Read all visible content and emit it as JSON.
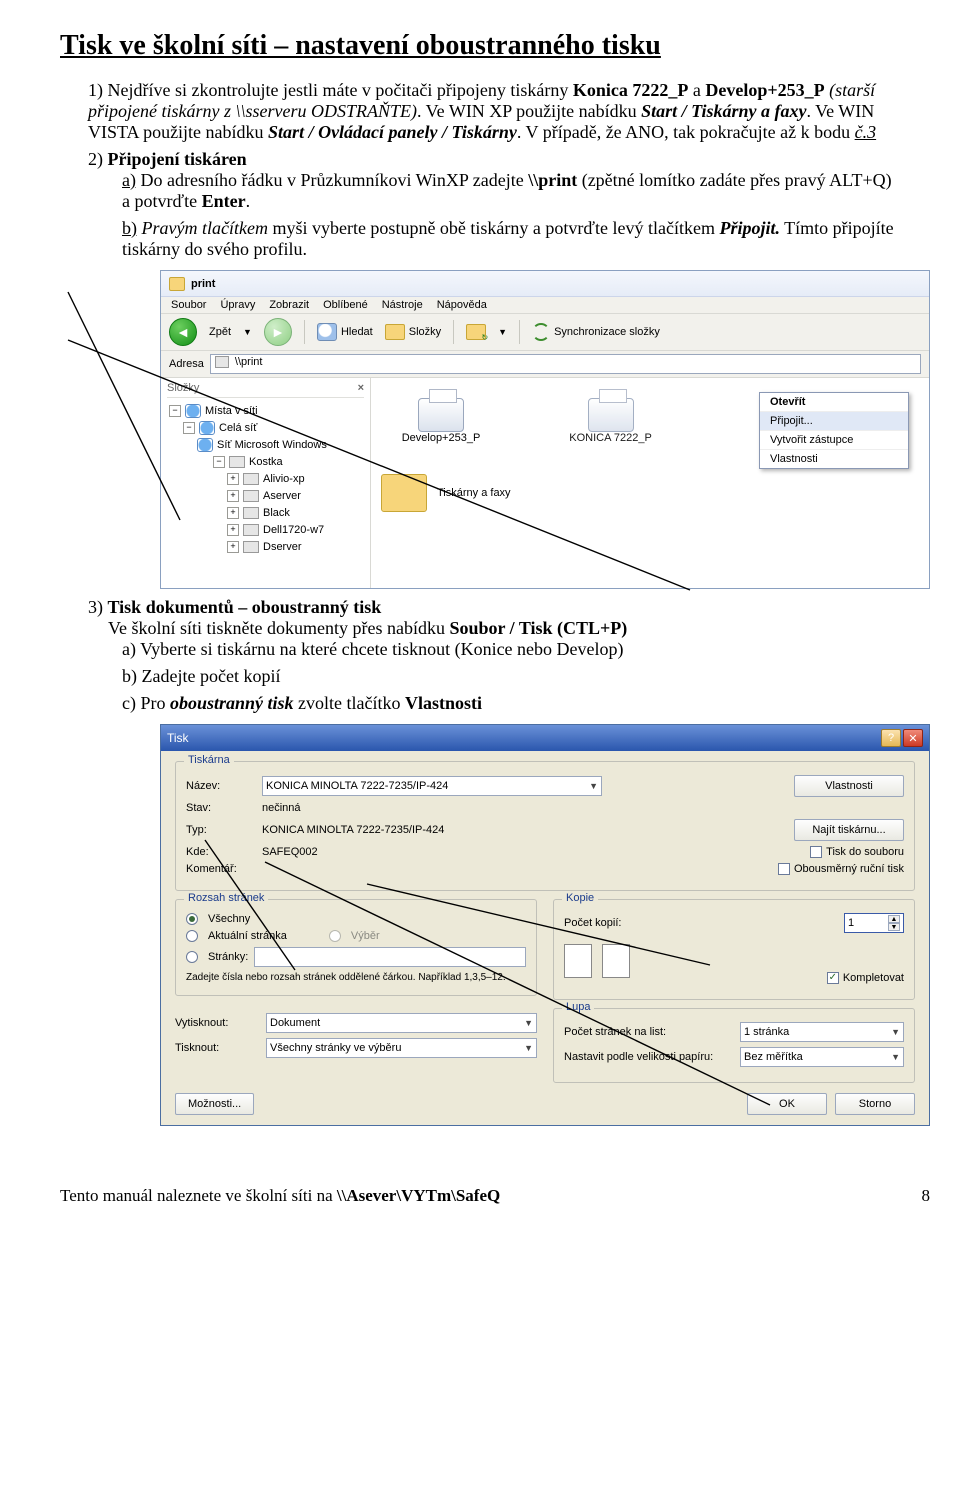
{
  "title": "Tisk ve školní síti – nastavení oboustranného tisku",
  "p1": {
    "num": "1)",
    "t1": "Nejdříve si zkontrolujte jestli máte v počitači připojeny tiskárny ",
    "b1": "Konica 7222_P",
    "t2": " a ",
    "b2": "Develop+253_P",
    "it": " (starší připojené tiskárny z \\\\sserveru ODSTRAŇTE)",
    "t3": ". Ve WIN XP použijte nabídku ",
    "bi1": "Start / Tiskárny a faxy",
    "t4": ". Ve WIN VISTA použijte nabídku ",
    "bi2": "Start / Ovládací panely / Tiskárny",
    "t5": ". V případě, že ANO, tak pokračujte až k bodu ",
    "iu": "č.3"
  },
  "p2": {
    "num": "2)",
    "head": "Připojení tiskáren",
    "a_num": "a)",
    "a1": "Do adresního řádku v Průzkumníkovi WinXP zadejte ",
    "a_b": "\\\\print",
    "a2": " (zpětné lomítko zadáte přes pravý ALT+Q) a potvrďte ",
    "a_b2": "Enter",
    "a3": ".",
    "b_num": "b)",
    "b_i": "Pravým tlačítkem",
    "b1": " myši vyberte postupně obě tiskárny a potvrďte levý tlačítkem ",
    "b_bi": "Připojit.",
    "b2": " Tímto připojíte tiskárny do svého profilu."
  },
  "explorer": {
    "title": "print",
    "menu": [
      "Soubor",
      "Úpravy",
      "Zobrazit",
      "Oblíbené",
      "Nástroje",
      "Nápověda"
    ],
    "back": "Zpět",
    "search": "Hledat",
    "folders": "Složky",
    "sync": "Synchronizace složky",
    "addr_lbl": "Adresa",
    "addr_val": "\\\\print",
    "side_head": "Složky",
    "tree": [
      "Místa v síti",
      "Celá síť",
      "Síť Microsoft Windows",
      "Kostka",
      "Alivio-xp",
      "Aserver",
      "Black",
      "Dell1720-w7",
      "Dserver"
    ],
    "items": {
      "p1": "Develop+253_P",
      "p2": "KONICA 7222_P",
      "f": "Tiskárny a faxy"
    },
    "ctx": [
      "Otevřít",
      "Připojit...",
      "Vytvořit zástupce",
      "Vlastnosti"
    ]
  },
  "p3": {
    "num": "3)",
    "head": "Tisk dokumentů – oboustranný tisk",
    "l1a": "Ve školní síti tiskněte dokumenty přes nabídku ",
    "l1b": "Soubor / Tisk (CTL+P)",
    "a_num": "a)",
    "a": "Vyberte si tiskárnu na které chcete tisknout (Konice nebo Develop)",
    "b_num": "b)",
    "b": "Zadejte počet kopií",
    "c_num": "c)",
    "c1": "Pro ",
    "c_bi": "oboustranný tisk",
    "c2": " zvolte tlačítko ",
    "c_b": "Vlastnosti"
  },
  "dialog": {
    "title": "Tisk",
    "grp_printer": "Tiskárna",
    "lbl_name": "Název:",
    "val_name": "KONICA MINOLTA 7222-7235/IP-424",
    "btn_props": "Vlastnosti",
    "lbl_state": "Stav:",
    "val_state": "nečinná",
    "lbl_type": "Typ:",
    "val_type": "KONICA MINOLTA 7222-7235/IP-424",
    "btn_find": "Najít tiskárnu...",
    "lbl_where": "Kde:",
    "val_where": "SAFEQ002",
    "chk_tofile": "Tisk do souboru",
    "lbl_comment": "Komentář:",
    "chk_duplex": "Obousměrný ruční tisk",
    "grp_range": "Rozsah stránek",
    "r_all": "Všechny",
    "r_cur": "Aktuální stránka",
    "r_sel": "Výběr",
    "r_pages": "Stránky:",
    "r_hint": "Zadejte čísla nebo rozsah stránek oddělené čárkou. Například 1,3,5–12.",
    "grp_copies": "Kopie",
    "lbl_ncopies": "Počet kopií:",
    "val_ncopies": "1",
    "chk_collate": "Kompletovat",
    "lbl_print1": "Vytisknout:",
    "val_print1": "Dokument",
    "lbl_print2": "Tisknout:",
    "val_print2": "Všechny stránky ve výběru",
    "grp_zoom": "Lupa",
    "lbl_pps": "Počet stránek na list:",
    "val_pps": "1 stránka",
    "lbl_scale": "Nastavit podle velikosti papíru:",
    "val_scale": "Bez měřítka",
    "btn_opts": "Možnosti...",
    "btn_ok": "OK",
    "btn_cancel": "Storno"
  },
  "footer": {
    "text": "Tento manuál naleznete ve školní síti na ",
    "path": "\\\\Asever\\VYTm\\SafeQ",
    "page": "8"
  }
}
